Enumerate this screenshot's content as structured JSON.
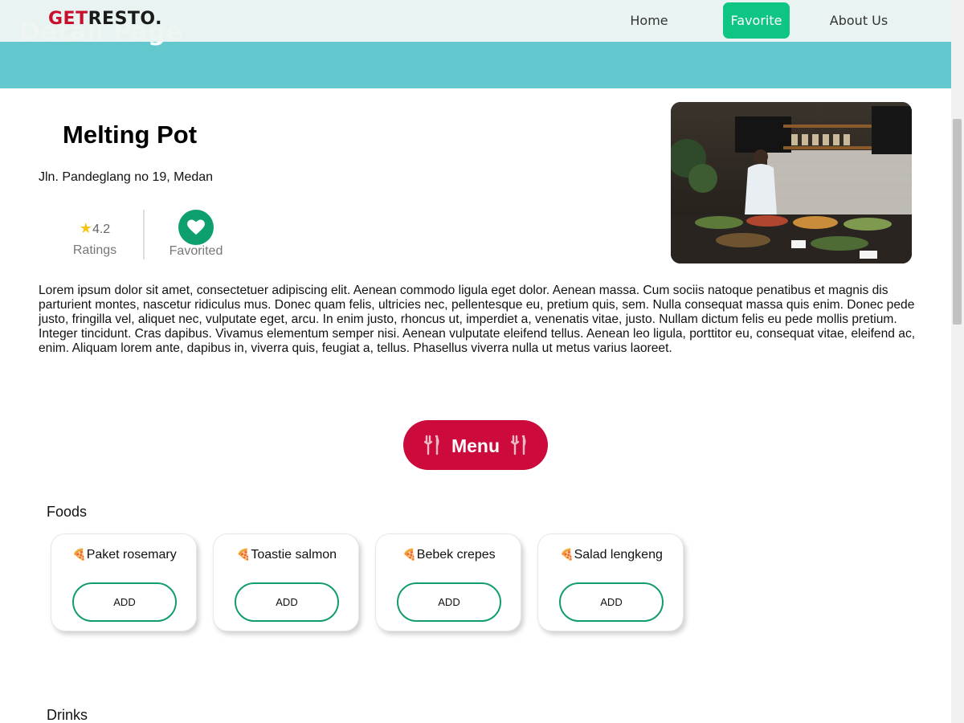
{
  "hero": {
    "title": "Detail Page"
  },
  "navbar": {
    "brand_part1": "GET",
    "brand_part2": "RESTO.",
    "links": [
      {
        "label": "Home"
      },
      {
        "label": "Favorite",
        "active": true
      },
      {
        "label": "About Us"
      }
    ]
  },
  "restaurant": {
    "name": "Melting Pot",
    "address": "Jln. Pandeglang no 19, Medan",
    "rating": "4.2",
    "rating_label": "Ratings",
    "favorite_label": "Favorited",
    "description": "Lorem ipsum dolor sit amet, consectetuer adipiscing elit. Aenean commodo ligula eget dolor. Aenean massa. Cum sociis natoque penatibus et magnis dis parturient montes, nascetur ridiculus mus. Donec quam felis, ultricies nec, pellentesque eu, pretium quis, sem. Nulla consequat massa quis enim. Donec pede justo, fringilla vel, aliquet nec, vulputate eget, arcu. In enim justo, rhoncus ut, imperdiet a, venenatis vitae, justo. Nullam dictum felis eu pede mollis pretium. Integer tincidunt. Cras dapibus. Vivamus elementum semper nisi. Aenean vulputate eleifend tellus. Aenean leo ligula, porttitor eu, consequat vitae, eleifend ac, enim. Aliquam lorem ante, dapibus in, viverra quis, feugiat a, tellus. Phasellus viverra nulla ut metus varius laoreet."
  },
  "menu": {
    "label": "Menu",
    "foods_title": "Foods",
    "drinks_title": "Drinks",
    "foods": [
      {
        "name": "Paket rosemary",
        "button": "ADD"
      },
      {
        "name": "Toastie salmon",
        "button": "ADD"
      },
      {
        "name": "Bebek crepes",
        "button": "ADD"
      },
      {
        "name": "Salad lengkeng",
        "button": "ADD"
      }
    ]
  },
  "colors": {
    "brand_red": "#c8102e",
    "hero_teal": "#63c8cd",
    "favorite_green": "#0fc583",
    "menu_pill": "#cc0a3c",
    "add_border": "#139c6f"
  },
  "icons": [
    "star-icon",
    "heart-icon",
    "fork-knife-icon",
    "pizza-icon"
  ]
}
